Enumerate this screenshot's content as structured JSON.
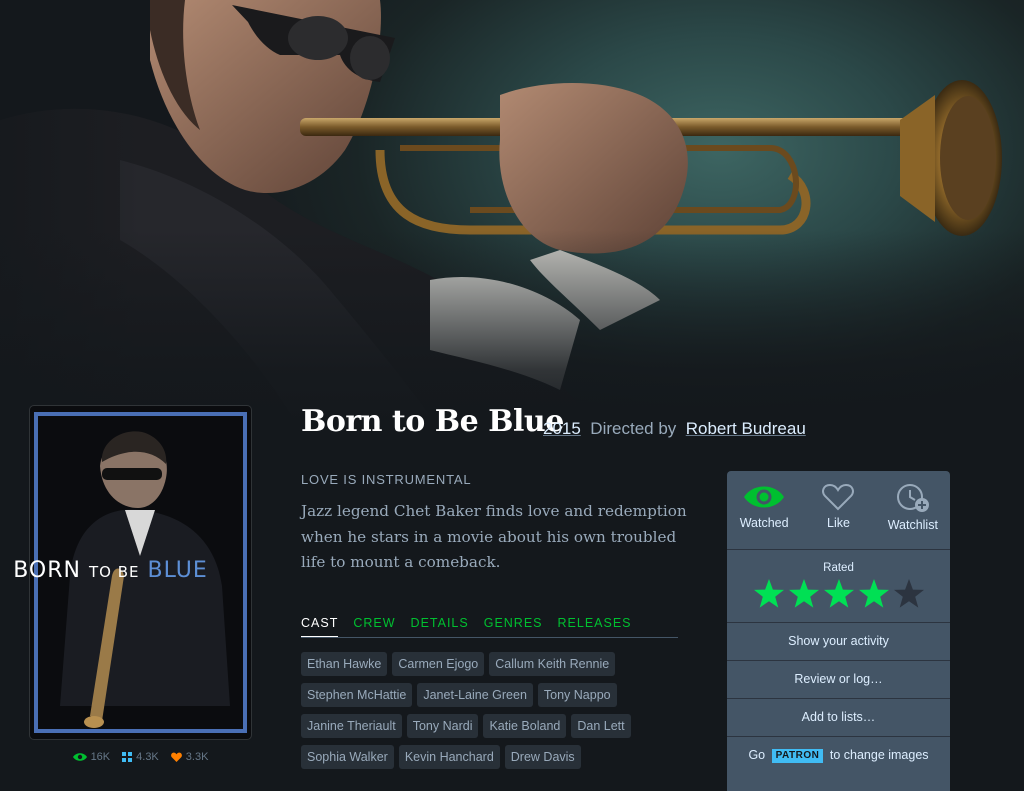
{
  "film": {
    "title": "Born to Be Blue",
    "year": "2015",
    "directed_by": "Directed by",
    "director": "Robert Budreau",
    "tagline": "LOVE IS INSTRUMENTAL",
    "synopsis": "Jazz legend Chet Baker finds love and redemption when he stars in a movie about his own troubled life to mount a comeback."
  },
  "poster": {
    "title_part1": "BORN",
    "title_part2": "TO BE",
    "title_part3": "BLUE",
    "stats": {
      "watched": "16K",
      "lists": "4.3K",
      "likes": "3.3K"
    }
  },
  "tabs": [
    {
      "label": "CAST",
      "active": true
    },
    {
      "label": "CREW"
    },
    {
      "label": "DETAILS"
    },
    {
      "label": "GENRES"
    },
    {
      "label": "RELEASES"
    }
  ],
  "cast": [
    "Ethan Hawke",
    "Carmen Ejogo",
    "Callum Keith Rennie",
    "Stephen McHattie",
    "Janet-Laine Green",
    "Tony Nappo",
    "Janine Theriault",
    "Tony Nardi",
    "Katie Boland",
    "Dan Lett",
    "Sophia Walker",
    "Kevin Hanchard",
    "Drew Davis"
  ],
  "actions": {
    "watched": "Watched",
    "like": "Like",
    "watchlist": "Watchlist",
    "rated_label": "Rated",
    "rating": 4,
    "rating_max": 5,
    "show_activity": "Show your activity",
    "review": "Review or log…",
    "add_to_lists": "Add to lists…",
    "go": "Go",
    "patron": "PATRON",
    "change_images": "to change images"
  },
  "colors": {
    "green": "#00c030",
    "star_green": "#00e054",
    "star_empty": "#2c3440",
    "patron_blue": "#40bcf4",
    "poster_blue": "#5d8fd6"
  }
}
